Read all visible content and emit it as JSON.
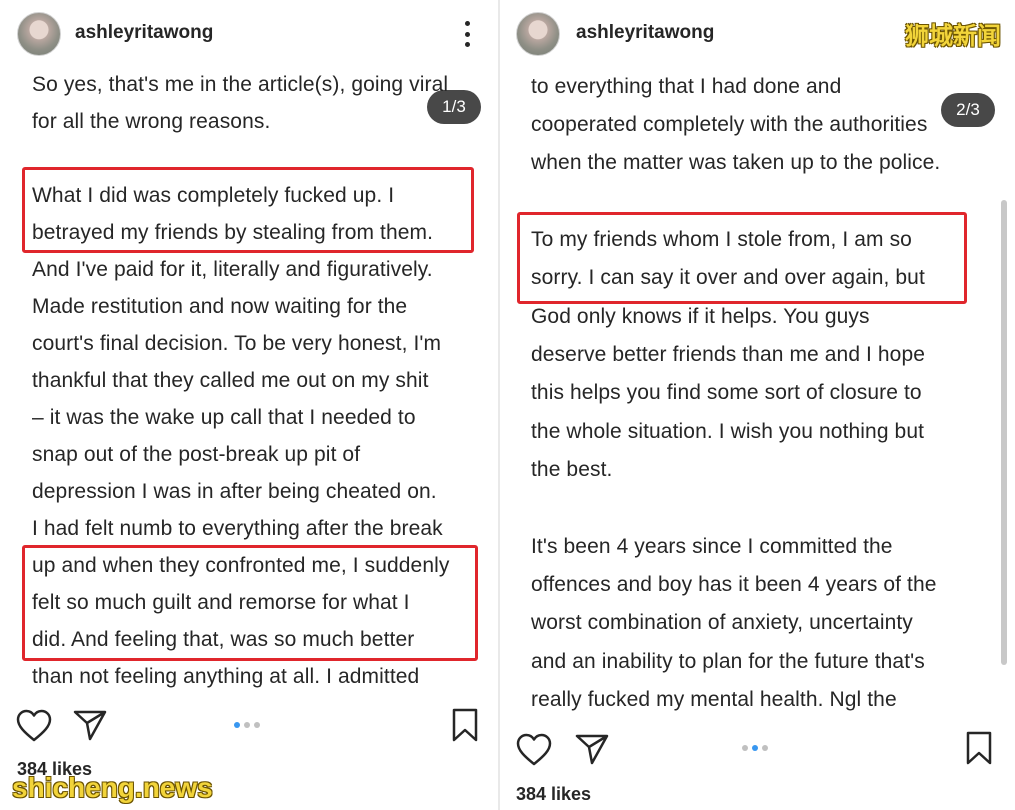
{
  "left": {
    "username": "ashleyritawong",
    "counter": "1/3",
    "lines": [
      "So yes, that's me in the article(s), going viral",
      "for all the wrong reasons.",
      "What I did was completely fucked up. I",
      "betrayed my friends by stealing from them.",
      "And I've paid for it, literally and figuratively.",
      "Made restitution and now waiting for the",
      "court's final decision. To be very honest, I'm",
      "thankful that they called me out on my shit",
      "– it was the wake up call that I needed to",
      "snap out of the post-break up pit of",
      "depression I was in after being cheated on.",
      "I had felt numb to everything after the break",
      "up and when they confronted me, I suddenly",
      "felt so much guilt and remorse for what I",
      "did. And feeling that, was so much better",
      "than not feeling anything at all. I admitted"
    ],
    "likes": "384 likes"
  },
  "right": {
    "username": "ashleyritawong",
    "counter": "2/3",
    "lines": [
      "to everything that I had done and",
      "cooperated completely with the authorities",
      "when the matter was taken up to the police.",
      "To my friends whom I stole from, I am so",
      "sorry. I can say it over and over again, but",
      "God only knows if it helps. You guys",
      "deserve better friends than me and I hope",
      "this helps you find some sort of closure to",
      "the whole situation. I wish you nothing but",
      "the best.",
      "It's been 4 years since I committed the",
      "offences and boy has it been 4 years of the",
      "worst combination of anxiety, uncertainty",
      "and an inability to plan for the future that's",
      "really fucked my mental health. Ngl the"
    ],
    "likes": "384 likes"
  },
  "watermarks": {
    "top_right": "狮城新闻",
    "bottom_left": "shicheng.news"
  },
  "icons": {
    "more": "more-vertical-icon",
    "like": "heart-icon",
    "share": "send-icon",
    "save": "bookmark-icon"
  },
  "colors": {
    "highlight": "#e0262c",
    "active_dot": "#3897f0",
    "text": "#262626"
  }
}
